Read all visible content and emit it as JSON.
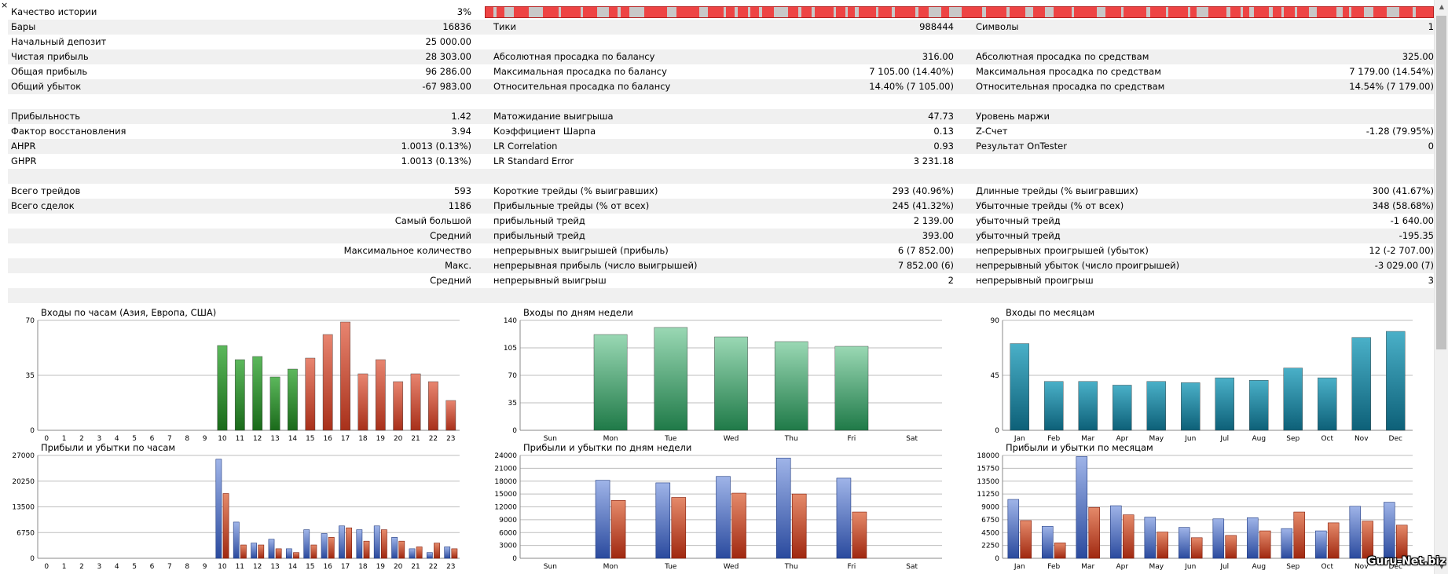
{
  "rows": [
    {
      "l1": "Качество истории",
      "v1": "3%",
      "quality_bar": true
    },
    {
      "l1": "Бары",
      "v1": "16836",
      "l2": "Тики",
      "v2": "988444",
      "l3": "Символы",
      "v3": "1",
      "shade": true
    },
    {
      "l1": "Начальный депозит",
      "v1": "25 000.00"
    },
    {
      "l1": "Чистая прибыль",
      "v1": "28 303.00",
      "l2": "Абсолютная просадка по балансу",
      "v2": "316.00",
      "l3": "Абсолютная просадка по средствам",
      "v3": "325.00",
      "shade": true
    },
    {
      "l1": "Общая прибыль",
      "v1": "96 286.00",
      "l2": "Максимальная просадка по балансу",
      "v2": "7 105.00 (14.40%)",
      "l3": "Максимальная просадка по средствам",
      "v3": "7 179.00 (14.54%)"
    },
    {
      "l1": "Общий убыток",
      "v1": "-67 983.00",
      "l2": "Относительная просадка по балансу",
      "v2": "14.40% (7 105.00)",
      "l3": "Относительная просадка по средствам",
      "v3": "14.54% (7 179.00)",
      "shade": true
    },
    {},
    {
      "l1": "Прибыльность",
      "v1": "1.42",
      "l2": "Матожидание выигрыша",
      "v2": "47.73",
      "l3": "Уровень маржи",
      "v3": "",
      "shade": true
    },
    {
      "l1": "Фактор восстановления",
      "v1": "3.94",
      "l2": "Коэффициент Шарпа",
      "v2": "0.13",
      "l3": "Z-Счет",
      "v3": "-1.28 (79.95%)"
    },
    {
      "l1": "AHPR",
      "v1": "1.0013 (0.13%)",
      "l2": "LR Correlation",
      "v2": "0.93",
      "l3": "Результат OnTester",
      "v3": "0",
      "shade": true
    },
    {
      "l1": "GHPR",
      "v1": "1.0013 (0.13%)",
      "l2": "LR Standard Error",
      "v2": "3 231.18"
    },
    {
      "shade": true
    },
    {
      "l1": "Всего трейдов",
      "v1": "593",
      "l2": "Короткие трейды (% выигравших)",
      "v2": "293 (40.96%)",
      "l3": "Длинные трейды (% выигравших)",
      "v3": "300 (41.67%)"
    },
    {
      "l1": "Всего сделок",
      "v1": "1186",
      "l2": "Прибыльные трейды (% от всех)",
      "v2": "245 (41.32%)",
      "l3": "Убыточные трейды (% от всех)",
      "v3": "348 (58.68%)",
      "shade": true
    },
    {
      "v1": "Самый большой",
      "l2": "прибыльный трейд",
      "v2": "2 139.00",
      "l3": "убыточный трейд",
      "v3": "-1 640.00"
    },
    {
      "v1": "Средний",
      "l2": "прибыльный трейд",
      "v2": "393.00",
      "l3": "убыточный трейд",
      "v3": "-195.35",
      "shade": true
    },
    {
      "v1": "Максимальное количество",
      "l2": "непрерывных выигрышей (прибыль)",
      "v2": "6 (7 852.00)",
      "l3": "непрерывных проигрышей (убыток)",
      "v3": "12 (-2 707.00)"
    },
    {
      "v1": "Макс.",
      "l2": "непрерывная прибыль (число выигрышей)",
      "v2": "7 852.00 (6)",
      "l3": "непрерывный убыток (число проигрышей)",
      "v3": "-3 029.00 (7)",
      "shade": true
    },
    {
      "v1": "Средний",
      "l2": "непрерывный выигрыш",
      "v2": "2",
      "l3": "непрерывный проигрыш",
      "v3": "3"
    },
    {
      "shade": true
    }
  ],
  "colors": {
    "quality_red": "#ee4444",
    "quality_gray": "#c8c8c8",
    "green": "#2f8f2f",
    "red": "#c0402a",
    "teal": "#1a7f96",
    "blue": "#3a5fb5",
    "sea_green": "#3a9a6a"
  },
  "watermark": "Guru-Net.biz",
  "chart_data": [
    {
      "id": "hours",
      "type": "bar",
      "title": "Входы по часам (Азия, Европа, США)",
      "categories": [
        "0",
        "1",
        "2",
        "3",
        "4",
        "5",
        "6",
        "7",
        "8",
        "9",
        "10",
        "11",
        "12",
        "13",
        "14",
        "15",
        "16",
        "17",
        "18",
        "19",
        "20",
        "21",
        "22",
        "23"
      ],
      "values": [
        0,
        0,
        0,
        0,
        0,
        0,
        0,
        0,
        0,
        0,
        54,
        45,
        47,
        34,
        39,
        46,
        61,
        69,
        36,
        45,
        31,
        36,
        31,
        19
      ],
      "ylim": [
        0,
        70
      ],
      "yticks": [
        "0",
        "35",
        "70"
      ],
      "colors": [
        "g",
        "g",
        "g",
        "g",
        "g",
        "g",
        "g",
        "g",
        "g",
        "g",
        "g",
        "g",
        "g",
        "g",
        "g",
        "r",
        "r",
        "r",
        "r",
        "r",
        "r",
        "r",
        "r",
        "r"
      ]
    },
    {
      "id": "weekdays",
      "type": "bar",
      "title": "Входы по дням недели",
      "categories": [
        "Sun",
        "Mon",
        "Tue",
        "Wed",
        "Thu",
        "Fri",
        "Sat"
      ],
      "values": [
        0,
        122,
        131,
        119,
        113,
        107,
        0
      ],
      "ylim": [
        0,
        140
      ],
      "yticks": [
        "0",
        "35",
        "70",
        "105",
        "140"
      ]
    },
    {
      "id": "months",
      "type": "bar",
      "title": "Входы по месяцам",
      "categories": [
        "Jan",
        "Feb",
        "Mar",
        "Apr",
        "May",
        "Jun",
        "Jul",
        "Aug",
        "Sep",
        "Oct",
        "Nov",
        "Dec"
      ],
      "values": [
        71,
        40,
        40,
        37,
        40,
        39,
        43,
        41,
        51,
        43,
        76,
        81
      ],
      "ylim": [
        0,
        90
      ],
      "yticks": [
        "0",
        "45",
        "90"
      ]
    },
    {
      "id": "pl_hours",
      "type": "bar",
      "title": "Прибыли и убытки по часам",
      "categories": [
        "0",
        "1",
        "2",
        "3",
        "4",
        "5",
        "6",
        "7",
        "8",
        "9",
        "10",
        "11",
        "12",
        "13",
        "14",
        "15",
        "16",
        "17",
        "18",
        "19",
        "20",
        "21",
        "22",
        "23"
      ],
      "series": [
        {
          "values": [
            0,
            0,
            0,
            0,
            0,
            0,
            0,
            0,
            0,
            0,
            26000,
            9500,
            4000,
            5000,
            2500,
            7500,
            6500,
            8500,
            7500,
            8500,
            5500,
            2500,
            1500,
            3000
          ]
        },
        {
          "values": [
            0,
            0,
            0,
            0,
            0,
            0,
            0,
            0,
            0,
            0,
            17000,
            3500,
            3500,
            2500,
            1500,
            3500,
            5500,
            8000,
            4500,
            7500,
            4500,
            3000,
            4000,
            2500
          ]
        }
      ],
      "ylim": [
        0,
        27000
      ],
      "yticks": [
        "0",
        "6750",
        "13500",
        "20250",
        "27000"
      ]
    },
    {
      "id": "pl_weekdays",
      "type": "bar",
      "title": "Прибыли и убытки по дням недели",
      "categories": [
        "Sun",
        "Mon",
        "Tue",
        "Wed",
        "Thu",
        "Fri",
        "Sat"
      ],
      "series": [
        {
          "values": [
            0,
            18200,
            17600,
            19100,
            23400,
            18700,
            0
          ]
        },
        {
          "values": [
            0,
            13500,
            14200,
            15200,
            15000,
            10800,
            0
          ]
        }
      ],
      "ylim": [
        0,
        24000
      ],
      "yticks": [
        "0",
        "3000",
        "6000",
        "9000",
        "12000",
        "15000",
        "18000",
        "21000",
        "24000"
      ]
    },
    {
      "id": "pl_months",
      "type": "bar",
      "title": "Прибыли и убытки по месяцам",
      "categories": [
        "Jan",
        "Feb",
        "Mar",
        "Apr",
        "May",
        "Jun",
        "Jul",
        "Aug",
        "Sep",
        "Oct",
        "Nov",
        "Dec"
      ],
      "series": [
        {
          "values": [
            10300,
            5600,
            17800,
            9200,
            7200,
            5400,
            6900,
            7100,
            5200,
            4800,
            9100,
            9800
          ]
        },
        {
          "values": [
            6600,
            2700,
            8900,
            7600,
            4600,
            3600,
            4000,
            4800,
            8100,
            6200,
            6500,
            5800
          ]
        }
      ],
      "ylim": [
        0,
        18000
      ],
      "yticks": [
        "0",
        "2250",
        "4500",
        "6750",
        "9000",
        "11250",
        "13500",
        "15750",
        "18000"
      ]
    }
  ]
}
